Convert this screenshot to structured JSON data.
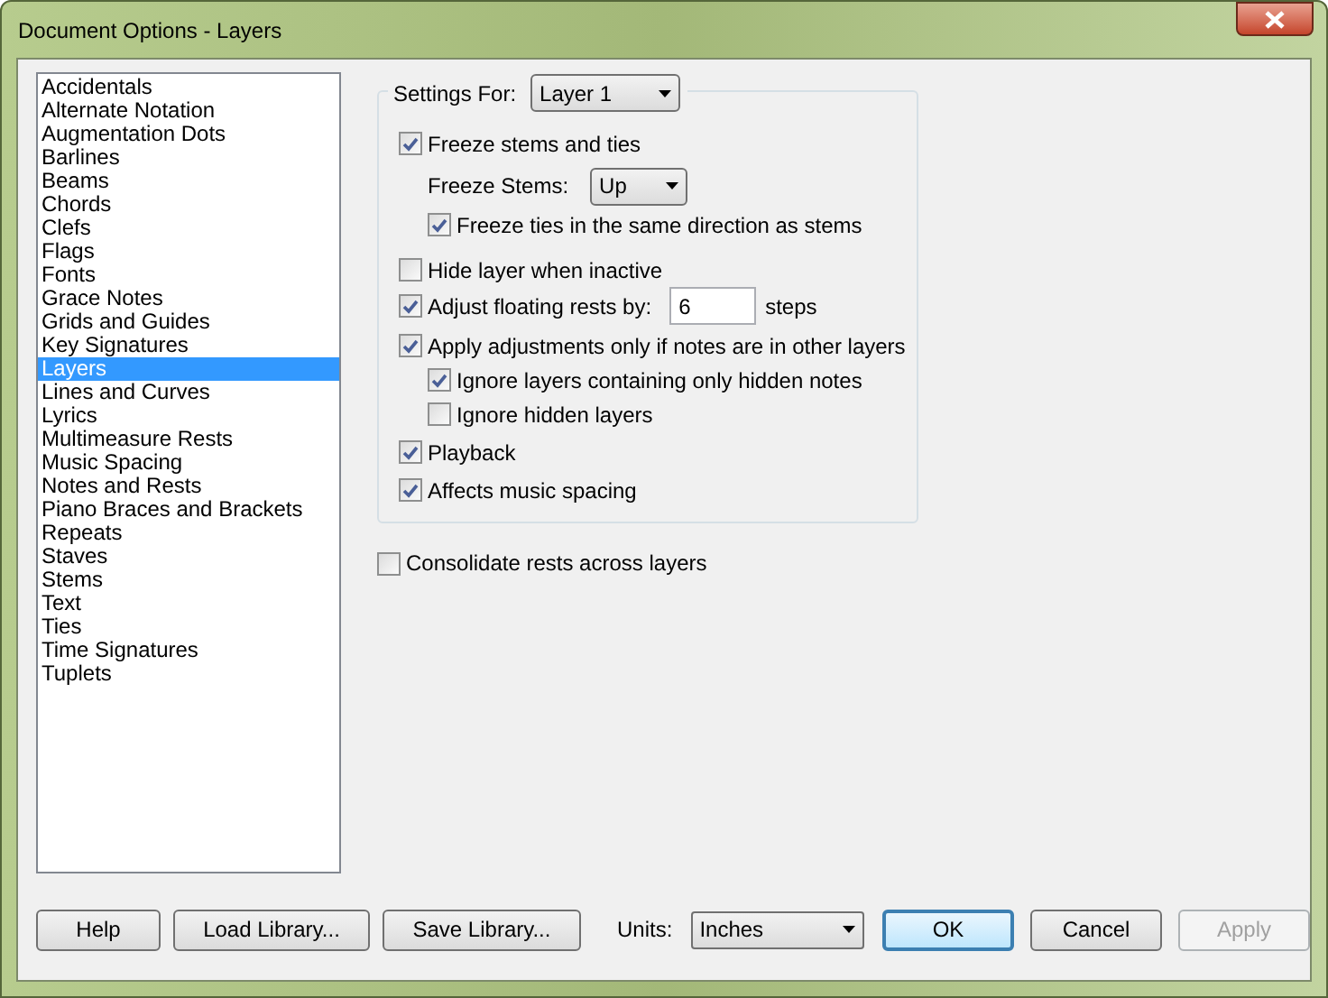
{
  "window": {
    "title": "Document Options - Layers"
  },
  "categories": [
    {
      "label": "Accidentals",
      "selected": false
    },
    {
      "label": "Alternate Notation",
      "selected": false
    },
    {
      "label": "Augmentation Dots",
      "selected": false
    },
    {
      "label": "Barlines",
      "selected": false
    },
    {
      "label": "Beams",
      "selected": false
    },
    {
      "label": "Chords",
      "selected": false
    },
    {
      "label": "Clefs",
      "selected": false
    },
    {
      "label": "Flags",
      "selected": false
    },
    {
      "label": "Fonts",
      "selected": false
    },
    {
      "label": "Grace Notes",
      "selected": false
    },
    {
      "label": "Grids and Guides",
      "selected": false
    },
    {
      "label": "Key Signatures",
      "selected": false
    },
    {
      "label": "Layers",
      "selected": true
    },
    {
      "label": "Lines and Curves",
      "selected": false
    },
    {
      "label": "Lyrics",
      "selected": false
    },
    {
      "label": "Multimeasure Rests",
      "selected": false
    },
    {
      "label": "Music Spacing",
      "selected": false
    },
    {
      "label": "Notes and Rests",
      "selected": false
    },
    {
      "label": "Piano Braces and Brackets",
      "selected": false
    },
    {
      "label": "Repeats",
      "selected": false
    },
    {
      "label": "Staves",
      "selected": false
    },
    {
      "label": "Stems",
      "selected": false
    },
    {
      "label": "Text",
      "selected": false
    },
    {
      "label": "Ties",
      "selected": false
    },
    {
      "label": "Time Signatures",
      "selected": false
    },
    {
      "label": "Tuplets",
      "selected": false
    }
  ],
  "settings_for": {
    "label": "Settings For:",
    "value": "Layer 1"
  },
  "options": [
    {
      "kind": "checkbox",
      "label": "Freeze stems and ties",
      "checked": true,
      "children": [
        {
          "kind": "select",
          "label": "Freeze Stems:",
          "value": "Up"
        },
        {
          "kind": "checkbox",
          "label": "Freeze ties in the same direction as stems",
          "checked": true
        }
      ]
    },
    {
      "kind": "checkbox",
      "label": "Hide layer when inactive",
      "checked": false
    },
    {
      "kind": "number",
      "label": "Adjust floating rests by:",
      "checked": true,
      "value": "6",
      "unit": "steps"
    },
    {
      "kind": "checkbox",
      "label": "Apply adjustments only if notes are in other layers",
      "checked": true,
      "children": [
        {
          "kind": "checkbox",
          "label": "Ignore layers containing only hidden notes",
          "checked": true
        },
        {
          "kind": "checkbox",
          "label": "Ignore hidden layers",
          "checked": false
        }
      ]
    },
    {
      "kind": "checkbox",
      "label": "Playback",
      "checked": true
    },
    {
      "kind": "checkbox",
      "label": "Affects music spacing",
      "checked": true
    }
  ],
  "consolidate": {
    "label": "Consolidate rests across layers",
    "checked": false
  },
  "buttons": [
    {
      "label": "Help",
      "disabled": false,
      "default": false
    },
    {
      "label": "Load Library...",
      "disabled": false,
      "default": false
    },
    {
      "label": "Save Library...",
      "disabled": false,
      "default": false
    }
  ],
  "units": {
    "label": "Units:",
    "value": "Inches"
  },
  "dialog_buttons": [
    {
      "label": "OK",
      "disabled": false,
      "default": true
    },
    {
      "label": "Cancel",
      "disabled": false,
      "default": false
    },
    {
      "label": "Apply",
      "disabled": true,
      "default": false
    }
  ]
}
